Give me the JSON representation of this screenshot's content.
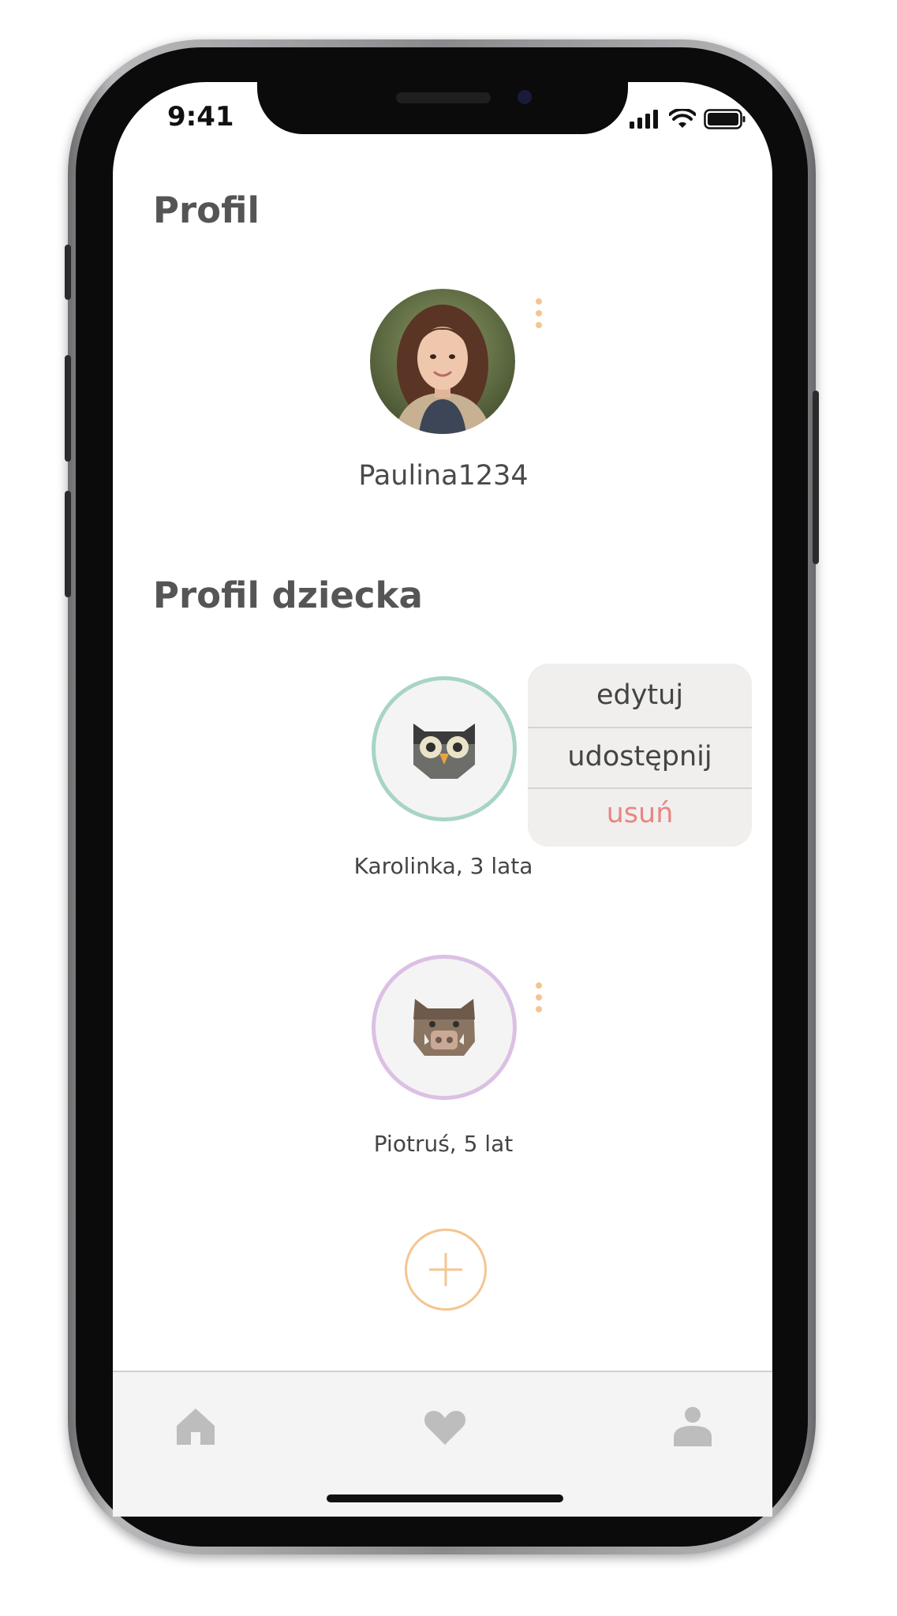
{
  "status_bar": {
    "time": "9:41"
  },
  "profile": {
    "title": "Profil",
    "username": "Paulina1234"
  },
  "children_section": {
    "title": "Profil dziecka",
    "children": [
      {
        "label": "Karolinka, 3 lata",
        "avatar_icon": "owl-icon",
        "ring_color": "#a8d4c4"
      },
      {
        "label": "Piotruś, 5 lat",
        "avatar_icon": "boar-icon",
        "ring_color": "#dcc0e4"
      }
    ]
  },
  "context_menu": {
    "items": [
      {
        "label": "edytuj"
      },
      {
        "label": "udostępnij"
      },
      {
        "label": "usuń"
      }
    ]
  },
  "colors": {
    "accent": "#f4c592",
    "danger": "#e98580",
    "heading": "#555555",
    "tab_icon": "#bdbdbd"
  },
  "tab_bar": {
    "items": [
      {
        "icon": "home-icon"
      },
      {
        "icon": "heart-icon"
      },
      {
        "icon": "person-icon"
      }
    ]
  }
}
